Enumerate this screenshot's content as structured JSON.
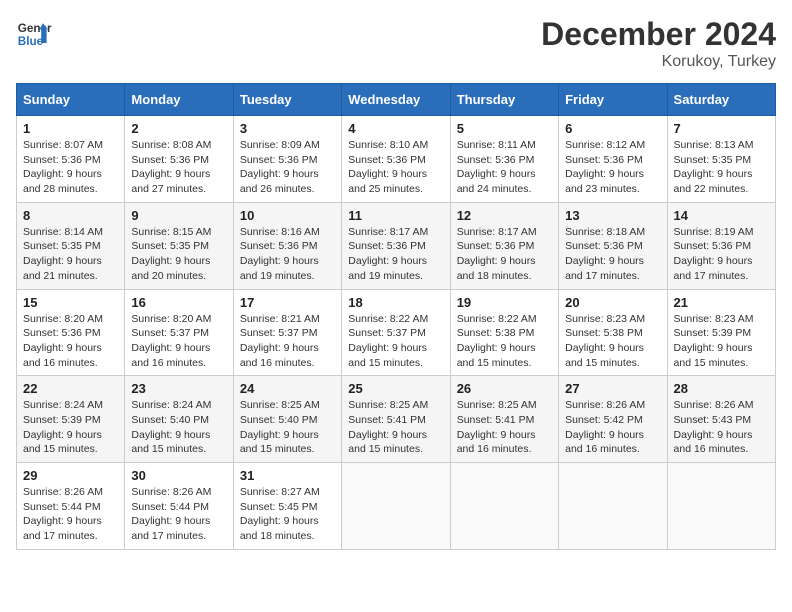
{
  "header": {
    "logo_line1": "General",
    "logo_line2": "Blue",
    "month": "December 2024",
    "location": "Korukoy, Turkey"
  },
  "days_of_week": [
    "Sunday",
    "Monday",
    "Tuesday",
    "Wednesday",
    "Thursday",
    "Friday",
    "Saturday"
  ],
  "weeks": [
    [
      {
        "day": 1,
        "sunrise": "8:07 AM",
        "sunset": "5:36 PM",
        "daylight": "9 hours and 28 minutes."
      },
      {
        "day": 2,
        "sunrise": "8:08 AM",
        "sunset": "5:36 PM",
        "daylight": "9 hours and 27 minutes."
      },
      {
        "day": 3,
        "sunrise": "8:09 AM",
        "sunset": "5:36 PM",
        "daylight": "9 hours and 26 minutes."
      },
      {
        "day": 4,
        "sunrise": "8:10 AM",
        "sunset": "5:36 PM",
        "daylight": "9 hours and 25 minutes."
      },
      {
        "day": 5,
        "sunrise": "8:11 AM",
        "sunset": "5:36 PM",
        "daylight": "9 hours and 24 minutes."
      },
      {
        "day": 6,
        "sunrise": "8:12 AM",
        "sunset": "5:36 PM",
        "daylight": "9 hours and 23 minutes."
      },
      {
        "day": 7,
        "sunrise": "8:13 AM",
        "sunset": "5:35 PM",
        "daylight": "9 hours and 22 minutes."
      }
    ],
    [
      {
        "day": 8,
        "sunrise": "8:14 AM",
        "sunset": "5:35 PM",
        "daylight": "9 hours and 21 minutes."
      },
      {
        "day": 9,
        "sunrise": "8:15 AM",
        "sunset": "5:35 PM",
        "daylight": "9 hours and 20 minutes."
      },
      {
        "day": 10,
        "sunrise": "8:16 AM",
        "sunset": "5:36 PM",
        "daylight": "9 hours and 19 minutes."
      },
      {
        "day": 11,
        "sunrise": "8:17 AM",
        "sunset": "5:36 PM",
        "daylight": "9 hours and 19 minutes."
      },
      {
        "day": 12,
        "sunrise": "8:17 AM",
        "sunset": "5:36 PM",
        "daylight": "9 hours and 18 minutes."
      },
      {
        "day": 13,
        "sunrise": "8:18 AM",
        "sunset": "5:36 PM",
        "daylight": "9 hours and 17 minutes."
      },
      {
        "day": 14,
        "sunrise": "8:19 AM",
        "sunset": "5:36 PM",
        "daylight": "9 hours and 17 minutes."
      }
    ],
    [
      {
        "day": 15,
        "sunrise": "8:20 AM",
        "sunset": "5:36 PM",
        "daylight": "9 hours and 16 minutes."
      },
      {
        "day": 16,
        "sunrise": "8:20 AM",
        "sunset": "5:37 PM",
        "daylight": "9 hours and 16 minutes."
      },
      {
        "day": 17,
        "sunrise": "8:21 AM",
        "sunset": "5:37 PM",
        "daylight": "9 hours and 16 minutes."
      },
      {
        "day": 18,
        "sunrise": "8:22 AM",
        "sunset": "5:37 PM",
        "daylight": "9 hours and 15 minutes."
      },
      {
        "day": 19,
        "sunrise": "8:22 AM",
        "sunset": "5:38 PM",
        "daylight": "9 hours and 15 minutes."
      },
      {
        "day": 20,
        "sunrise": "8:23 AM",
        "sunset": "5:38 PM",
        "daylight": "9 hours and 15 minutes."
      },
      {
        "day": 21,
        "sunrise": "8:23 AM",
        "sunset": "5:39 PM",
        "daylight": "9 hours and 15 minutes."
      }
    ],
    [
      {
        "day": 22,
        "sunrise": "8:24 AM",
        "sunset": "5:39 PM",
        "daylight": "9 hours and 15 minutes."
      },
      {
        "day": 23,
        "sunrise": "8:24 AM",
        "sunset": "5:40 PM",
        "daylight": "9 hours and 15 minutes."
      },
      {
        "day": 24,
        "sunrise": "8:25 AM",
        "sunset": "5:40 PM",
        "daylight": "9 hours and 15 minutes."
      },
      {
        "day": 25,
        "sunrise": "8:25 AM",
        "sunset": "5:41 PM",
        "daylight": "9 hours and 15 minutes."
      },
      {
        "day": 26,
        "sunrise": "8:25 AM",
        "sunset": "5:41 PM",
        "daylight": "9 hours and 16 minutes."
      },
      {
        "day": 27,
        "sunrise": "8:26 AM",
        "sunset": "5:42 PM",
        "daylight": "9 hours and 16 minutes."
      },
      {
        "day": 28,
        "sunrise": "8:26 AM",
        "sunset": "5:43 PM",
        "daylight": "9 hours and 16 minutes."
      }
    ],
    [
      {
        "day": 29,
        "sunrise": "8:26 AM",
        "sunset": "5:44 PM",
        "daylight": "9 hours and 17 minutes."
      },
      {
        "day": 30,
        "sunrise": "8:26 AM",
        "sunset": "5:44 PM",
        "daylight": "9 hours and 17 minutes."
      },
      {
        "day": 31,
        "sunrise": "8:27 AM",
        "sunset": "5:45 PM",
        "daylight": "9 hours and 18 minutes."
      },
      null,
      null,
      null,
      null
    ]
  ],
  "labels": {
    "sunrise": "Sunrise:",
    "sunset": "Sunset:",
    "daylight": "Daylight:"
  }
}
